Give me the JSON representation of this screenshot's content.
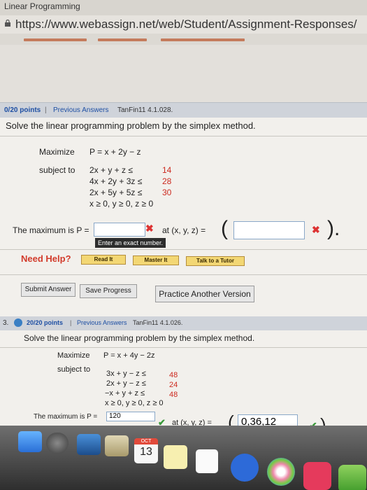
{
  "browser": {
    "tab_title": "Linear Programming",
    "url": "https://www.webassign.net/web/Student/Assignment-Responses/"
  },
  "question1": {
    "points": "0/20 points",
    "sep": "|",
    "previous_answers": "Previous Answers",
    "code": "TanFin11 4.1.028.",
    "prompt": "Solve the linear programming problem by the simplex method.",
    "maximize_label": "Maximize",
    "objective": "P = x + 2y − z",
    "subject_to_label": "subject to",
    "constraints": [
      {
        "lhs": "2x +  y +  z ≤",
        "rhs": "14"
      },
      {
        "lhs": "4x + 2y + 3z ≤",
        "rhs": "28"
      },
      {
        "lhs": "2x + 5y + 5z ≤",
        "rhs": "30"
      }
    ],
    "nonneg": "x ≥ 0, y ≥ 0, z ≥ 0",
    "max_label": "The maximum is P =",
    "at_label": "at (x, y, z) =",
    "tooltip": "Enter an exact number.",
    "need_help": "Need Help?",
    "read_it": "Read It",
    "master_it": "Master It",
    "talk_tutor": "Talk to a Tutor",
    "submit_answer": "Submit Answer",
    "save_progress": "Save Progress",
    "practice_another": "Practice Another Version"
  },
  "question2": {
    "number": "3.",
    "points": "20/20 points",
    "sep": "|",
    "previous_answers": "Previous Answers",
    "code": "TanFin11 4.1.026.",
    "prompt": "Solve the linear programming problem by the simplex method.",
    "maximize_label": "Maximize",
    "objective": "P = x + 4y − 2z",
    "subject_to_label": "subject to",
    "constraints": [
      {
        "lhs": "3x + y − z ≤",
        "rhs": "48"
      },
      {
        "lhs": "2x + y − z ≤",
        "rhs": "24"
      },
      {
        "lhs": "−x + y + z ≤",
        "rhs": "48"
      }
    ],
    "nonneg": "x ≥ 0, y ≥ 0, z ≥ 0",
    "max_label": "The maximum is P =",
    "max_value": "120",
    "at_label": "at (x, y, z) =",
    "at_value": "0,36,12"
  },
  "dock": {
    "calendar_month": "OCT",
    "calendar_day": "13"
  },
  "colors": {
    "correct": "#3a9a3a",
    "incorrect": "#cc2a1f",
    "help_button": "#f3d774"
  }
}
